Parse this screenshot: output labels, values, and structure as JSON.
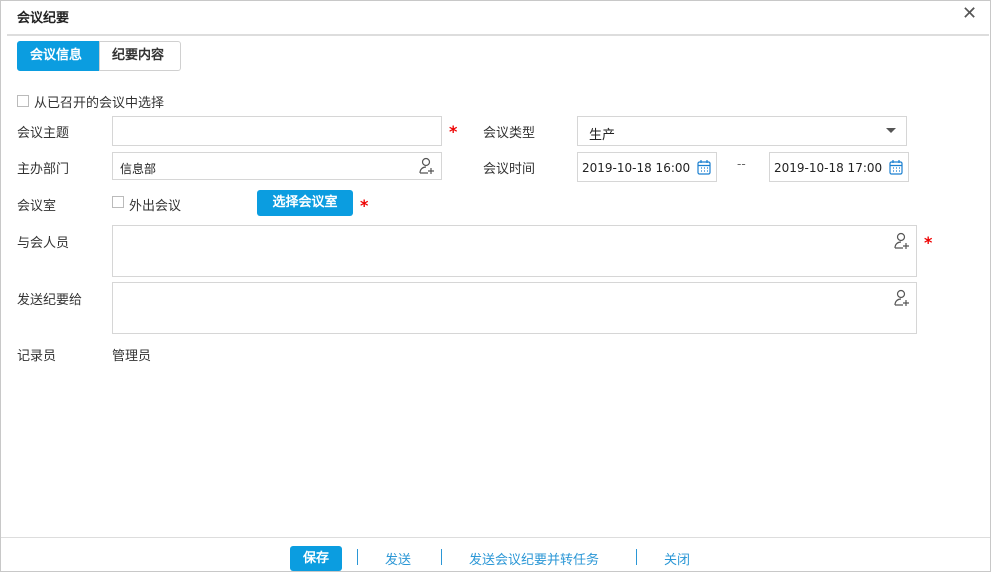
{
  "window": {
    "title": "会议纪要",
    "close_icon": "close-icon"
  },
  "tabs": [
    {
      "label": "会议信息",
      "active": true
    },
    {
      "label": "纪要内容",
      "active": false
    }
  ],
  "form": {
    "select_existing_label": "从已召开的会议中选择",
    "subject": {
      "label": "会议主题",
      "value": ""
    },
    "type": {
      "label": "会议类型",
      "value": "生产"
    },
    "dept": {
      "label": "主办部门",
      "value": "信息部"
    },
    "time": {
      "label": "会议时间",
      "start": "2019-10-18 16:00",
      "separator": "--",
      "end": "2019-10-18 17:00"
    },
    "room": {
      "label": "会议室",
      "outside_label": "外出会议",
      "select_button": "选择会议室"
    },
    "attendees": {
      "label": "与会人员",
      "value": ""
    },
    "send_to": {
      "label": "发送纪要给",
      "value": ""
    },
    "recorder": {
      "label": "记录员",
      "value": "管理员"
    },
    "required_mark": "*"
  },
  "footer": {
    "save": "保存",
    "send": "发送",
    "send_task": "发送会议纪要并转任务",
    "close": "关闭"
  },
  "colors": {
    "accent": "#0b9de0",
    "required": "#ee0000",
    "link": "#2b97d6"
  }
}
